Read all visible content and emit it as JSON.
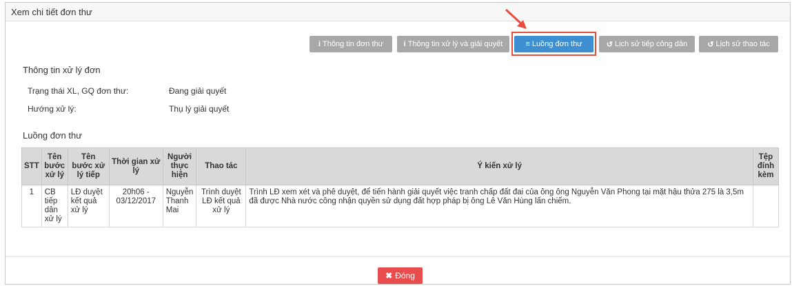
{
  "modal": {
    "title": "Xem chi tiết đơn thư"
  },
  "buttons": [
    {
      "label": "Thông tin đơn thư",
      "icon_glyph": "i",
      "icon": "info-icon"
    },
    {
      "label": "Thông tin xử lý và giải quyết",
      "icon_glyph": "i",
      "icon": "info-icon"
    },
    {
      "label": "Luồng đơn thư",
      "icon_glyph": "≡",
      "icon": "list-icon",
      "active": true
    },
    {
      "label": "Lịch sử tiếp công dân",
      "icon_glyph": "↺",
      "icon": "history-icon"
    },
    {
      "label": "Lịch sử thao tác",
      "icon_glyph": "↺",
      "icon": "history-icon"
    }
  ],
  "processing": {
    "title": "Thông tin xử lý đơn",
    "status_label": "Trạng thái XL, GQ đơn thư:",
    "status_value": "Đang giải quyết",
    "direction_label": "Hướng xử lý:",
    "direction_value": "Thụ lý giải quyết"
  },
  "flow": {
    "title": "Luồng đơn thư",
    "columns": [
      "STT",
      "Tên bước xử lý",
      "Tên bước xử lý tiếp",
      "Thời gian xử lý",
      "Người thực hiện",
      "Thao tác",
      "Ý kiến xử lý",
      "Tệp đính kèm"
    ],
    "rows": [
      {
        "stt": "1",
        "step": "CB tiếp dân xử lý",
        "next_step": "LĐ duyệt kết quả xử lý",
        "time": "20h06 - 03/12/2017",
        "person": "Nguyễn Thanh Mai",
        "action": "Trình duyệt LĐ kết quả xử lý",
        "opinion": "Trình LĐ xem xét và phê duyệt, để tiến hành giải quyết việc tranh chấp đất đai của ông ông Nguyễn Văn Phong tại mặt hậu thửa 275 là 3,5m đã được Nhà nước công nhận quyền sử dụng đất hợp pháp bị ông Lê Văn Hùng lấn chiếm.",
        "attachment": ""
      }
    ]
  },
  "footer": {
    "close_label": "Đóng",
    "close_glyph": "✖"
  },
  "colors": {
    "active_button": "#3d8fd1",
    "inactive_button": "#a8a8a8",
    "close_button": "#e84c4c",
    "highlight": "#e74c3c"
  }
}
